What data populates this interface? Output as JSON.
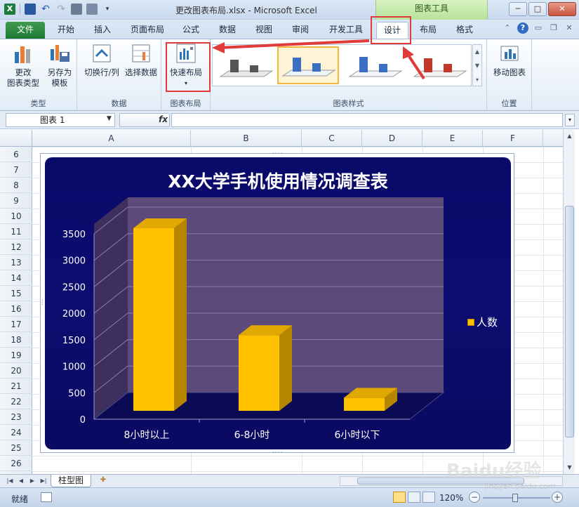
{
  "window": {
    "title": "更改图表布局.xlsx - Microsoft Excel",
    "context_group": "图表工具"
  },
  "tabs": [
    "文件",
    "开始",
    "插入",
    "页面布局",
    "公式",
    "数据",
    "视图",
    "审阅",
    "开发工具",
    "设计",
    "布局",
    "格式"
  ],
  "ribbon": {
    "groups": {
      "type": "类型",
      "data": "数据",
      "layout": "图表布局",
      "styles": "图表样式",
      "position": "位置"
    },
    "buttons": {
      "change_type": "更改\n图表类型",
      "save_template": "另存为\n模板",
      "switch_row_col": "切换行/列",
      "select_data": "选择数据",
      "quick_layout": "快速布局",
      "move_chart": "移动图表"
    }
  },
  "formula_bar": {
    "name_box": "图表 1",
    "fx": "fx"
  },
  "columns": [
    "A",
    "B",
    "C",
    "D",
    "E",
    "F"
  ],
  "rows": [
    "6",
    "7",
    "8",
    "9",
    "10",
    "11",
    "12",
    "13",
    "14",
    "15",
    "16",
    "17",
    "18",
    "19",
    "20",
    "21",
    "22",
    "23",
    "24",
    "25",
    "26"
  ],
  "chart_data": {
    "type": "bar",
    "title": "XX大学手机使用情况调查表",
    "categories": [
      "8小时以上",
      "6-8小时",
      "6小时以下"
    ],
    "series": [
      {
        "name": "人数",
        "values": [
          3500,
          1450,
          250
        ]
      }
    ],
    "ylim": [
      0,
      3500
    ],
    "yticks": [
      0,
      500,
      1000,
      1500,
      2000,
      2500,
      3000,
      3500
    ],
    "legend": "right",
    "grid": true,
    "colors": {
      "bar": "#ffc000",
      "background": "#0c0c6e",
      "wall": "#5b4a7a"
    }
  },
  "sheet": {
    "tab": "柱型图"
  },
  "status": {
    "ready": "就绪",
    "zoom": "120%"
  },
  "watermark": {
    "logo": "Baidu经验",
    "url": "jingyan.baidu.com"
  },
  "icons": {
    "app": "excel-icon",
    "save": "save-icon",
    "undo": "undo-icon",
    "redo": "redo-icon"
  }
}
